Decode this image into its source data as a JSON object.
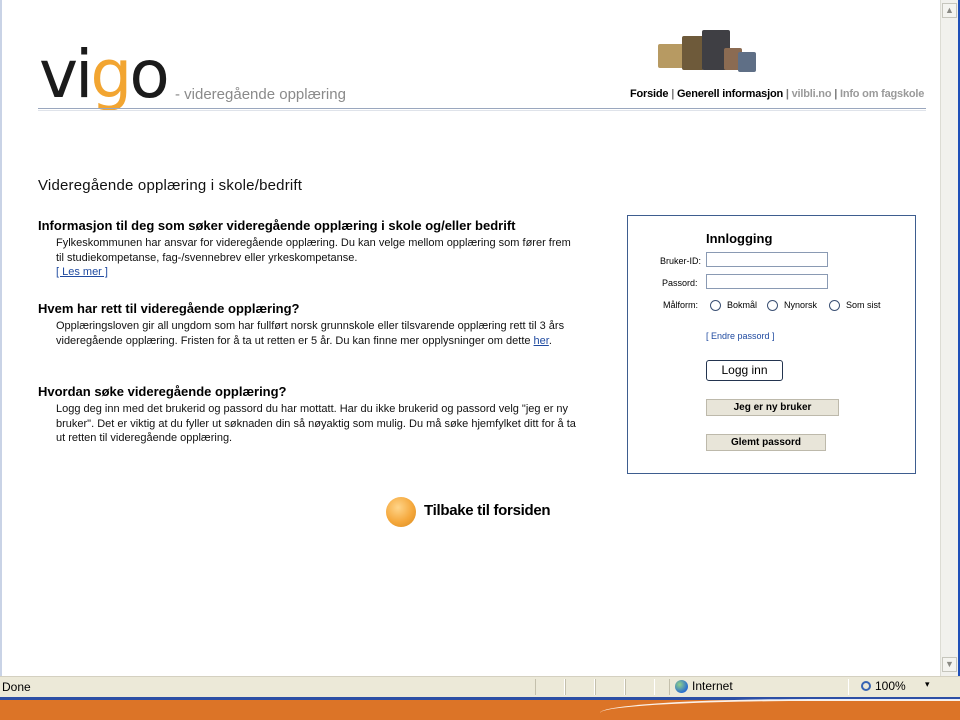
{
  "header": {
    "logo_main": "vi",
    "logo_g": "g",
    "logo_end": "o",
    "logo_sub": "- videregående opplæring",
    "nav": [
      {
        "label": "Forside",
        "dim": false
      },
      {
        "label": "Generell informasjon",
        "dim": false
      },
      {
        "label": "vilbli.no",
        "dim": true
      },
      {
        "label": "Info om fagskole",
        "dim": true
      }
    ],
    "nav_separator": "|"
  },
  "main": {
    "title": "Videregående opplæring i skole/bedrift",
    "sections": [
      {
        "heading": "Informasjon til deg som søker videregående opplæring i skole og/eller bedrift",
        "text": "Fylkeskommunen har ansvar for videregående opplæring. Du kan velge mellom opplæring som fører frem til studiekompetanse, fag-/svennebrev eller yrkeskompetanse.",
        "more": "[ Les mer ]"
      },
      {
        "heading": "Hvem har rett til videregående opplæring?",
        "text": "Opplæringsloven gir all ungdom som har fullført norsk grunnskole eller tilsvarende opplæring rett til 3 års videregående opplæring. Fristen for å ta ut retten er 5 år. Du kan finne mer opplysninger om dette ",
        "link": "her",
        "after": "."
      },
      {
        "heading": "Hvordan søke videregående opplæring?",
        "text": "Logg deg inn med det brukerid og passord du har mottatt. Har du ikke brukerid og passord velg \"jeg er ny bruker\". Det er viktig at du fyller ut søknaden din så nøyaktig som mulig. Du må søke hjemfylket ditt for å ta ut retten til videregående opplæring."
      }
    ],
    "back_link": "Tilbake til forsiden"
  },
  "login": {
    "title": "Innlogging",
    "user_label": "Bruker-ID:",
    "user_value": "",
    "pass_label": "Passord:",
    "pass_value": "",
    "lang_label": "Målform:",
    "options": [
      "Bokmål",
      "Nynorsk",
      "Som sist"
    ],
    "change_password": "[ Endre passord ]",
    "login_button": "Logg inn",
    "new_user_button": "Jeg er ny bruker",
    "forgot_button": "Glemt passord"
  },
  "statusbar": {
    "status": "Done",
    "zone": "Internet",
    "zoom": "100%",
    "zoom_dropdown": "▾"
  },
  "colors": {
    "logo_accent": "#f2a531",
    "link": "#1f4aa0",
    "login_border": "#3e5d8f",
    "bottom_band": "#dc7427"
  }
}
